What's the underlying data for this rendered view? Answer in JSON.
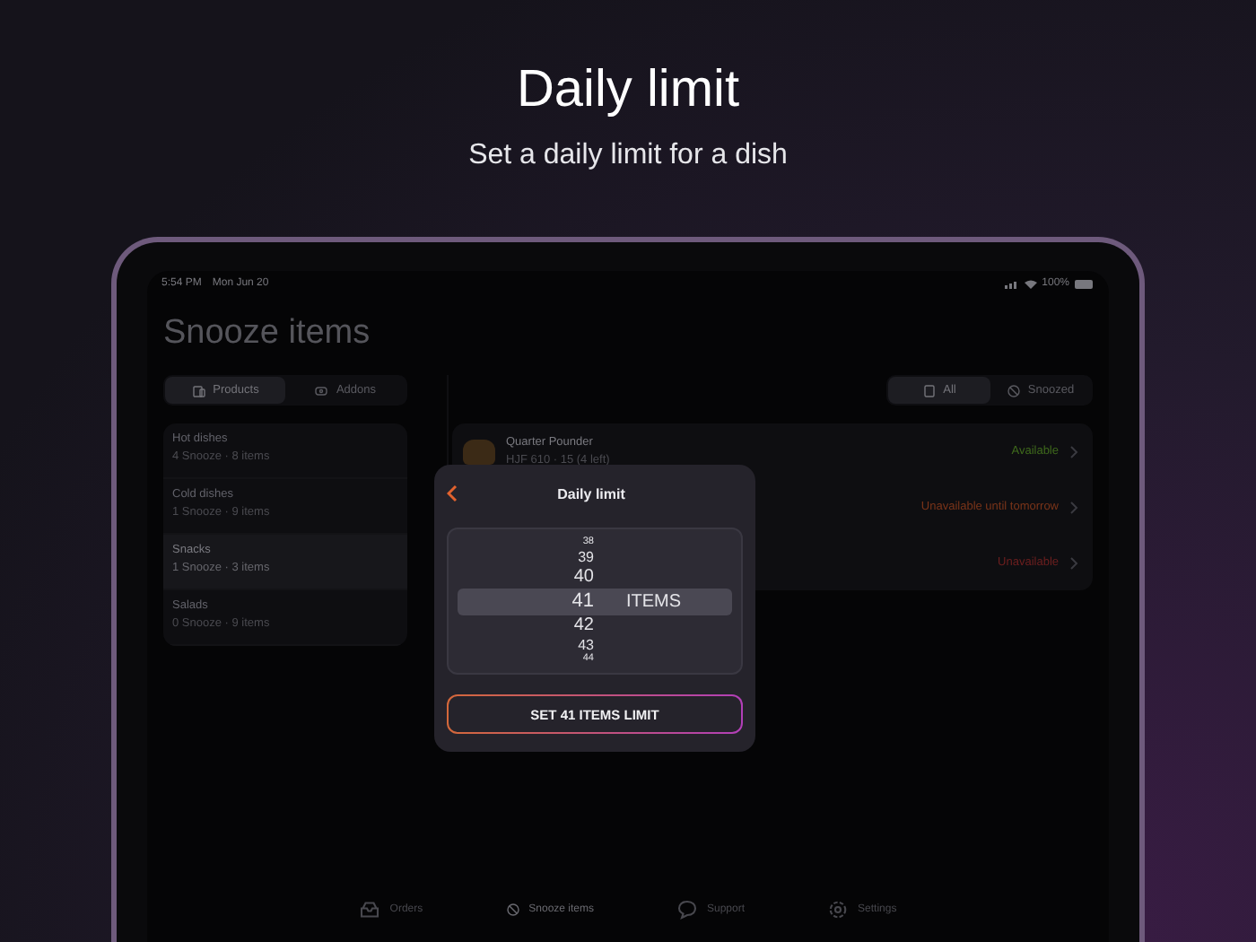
{
  "headline": {
    "title": "Daily limit",
    "subtitle": "Set a daily limit for a dish"
  },
  "status_bar": {
    "time": "5:54 PM",
    "date": "Mon Jun 20",
    "battery": "100%"
  },
  "screen_title": "Snooze items",
  "type_tabs": [
    {
      "label": "Products",
      "selected": true
    },
    {
      "label": "Addons",
      "selected": false
    }
  ],
  "categories": [
    {
      "name": "Hot dishes",
      "meta": "4 Snooze · 8 items",
      "selected": false
    },
    {
      "name": "Cold dishes",
      "meta": "1 Snooze · 9 items",
      "selected": false
    },
    {
      "name": "Snacks",
      "meta": "1 Snooze · 3 items",
      "selected": true
    },
    {
      "name": "Salads",
      "meta": "0 Snooze · 9 items",
      "selected": false
    }
  ],
  "filter_tabs": [
    {
      "label": "All",
      "selected": true
    },
    {
      "label": "Snoozed",
      "selected": false
    }
  ],
  "products": [
    {
      "name": "Quarter Pounder",
      "meta": "HJF 610 · 15 (4 left)",
      "status": "Available",
      "color": "#3f6a1c"
    },
    {
      "status": "Unavailable until tomorrow",
      "color": "#7a3419"
    },
    {
      "status": "Unavailable",
      "color": "#6e1f1f"
    }
  ],
  "modal": {
    "title": "Daily limit",
    "unit": "ITEMS",
    "button": "SET 41 ITEMS LIMIT",
    "values": [
      {
        "label": "38",
        "selected": false
      },
      {
        "label": "39",
        "selected": false
      },
      {
        "label": "40",
        "selected": false
      },
      {
        "label": "41",
        "selected": true
      },
      {
        "label": "42",
        "selected": false
      },
      {
        "label": "43",
        "selected": false
      },
      {
        "label": "44",
        "selected": false
      }
    ]
  },
  "bottom_tabs": [
    {
      "label": "Orders",
      "selected": false
    },
    {
      "label": "Snooze items",
      "selected": true
    },
    {
      "label": "Support",
      "selected": false
    },
    {
      "label": "Settings",
      "selected": false
    }
  ]
}
